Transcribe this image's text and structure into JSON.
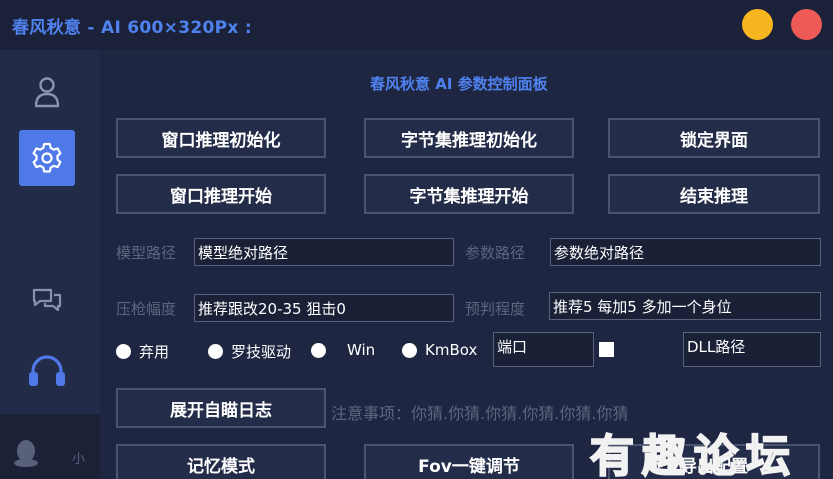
{
  "window": {
    "title": "春风秋意 - AI  600×320Px :",
    "minimize_color": "#f7b51f",
    "close_color": "#ee5a55"
  },
  "sidebar": {
    "items": [
      {
        "icon": "user-icon"
      },
      {
        "icon": "gear-icon",
        "active": true
      },
      {
        "icon": "chat-icon"
      },
      {
        "icon": "headset-icon"
      },
      {
        "icon": "qq-penguin-icon"
      }
    ],
    "qq_label": "小"
  },
  "panel": {
    "title": "春风秋意 AI 参数控制面板",
    "buttons": {
      "window_init": "窗口推理初始化",
      "byteset_init": "字节集推理初始化",
      "lock_ui": "锁定界面",
      "window_start": "窗口推理开始",
      "byteset_start": "字节集推理开始",
      "end_infer": "结束推理",
      "expand_log": "展开自瞄日志",
      "memory_mode": "记忆模式",
      "fov_adjust": "Fov一键调节",
      "export_config": "导出配置"
    },
    "fields": {
      "model_path_label": "模型路径",
      "model_path_value": "模型绝对路径",
      "param_path_label": "参数路径",
      "param_path_value": "参数绝对路径",
      "recoil_label": "压枪幅度",
      "recoil_value": "推荐跟改20-35 狙击0",
      "predict_label": "预判程度",
      "predict_value": "推荐5 每加5 多加一个身位",
      "port_value": "端口",
      "dll_value": "DLL路径"
    },
    "radios": [
      "弃用",
      "罗技驱动",
      "Win",
      "KmBox"
    ],
    "notice": "注意事项：你猜.你猜.你猜.你猜.你猜.你猜",
    "accent": "#4f82ee",
    "active_color": "#4f78e8"
  },
  "watermark": "有趣论坛"
}
